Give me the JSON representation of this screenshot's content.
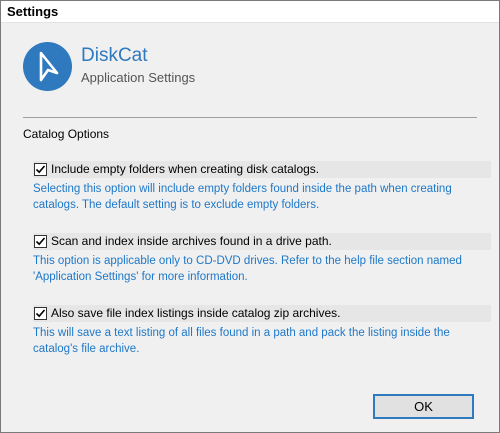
{
  "window": {
    "title": "Settings"
  },
  "header": {
    "app_name": "DiskCat",
    "subtitle": "Application Settings",
    "logo_icon": "arrow-cursor-icon",
    "accent_color": "#2f79bf"
  },
  "catalog_options": {
    "label": "Catalog Options",
    "options": [
      {
        "checked": true,
        "label": "Include empty folders when creating disk catalogs.",
        "description": "Selecting this option will include empty folders found inside the path when creating catalogs. The default setting is to exclude empty folders."
      },
      {
        "checked": true,
        "label": "Scan and index inside archives found in a drive path.",
        "description": "This option is applicable only to CD-DVD drives. Refer to the help file section named 'Application Settings' for more information."
      },
      {
        "checked": true,
        "label": "Also save file index listings inside catalog zip archives.",
        "description": "This will save a text listing of all files found in a path and pack the listing inside the catalog's file archive."
      }
    ]
  },
  "footer": {
    "ok_label": "OK"
  }
}
